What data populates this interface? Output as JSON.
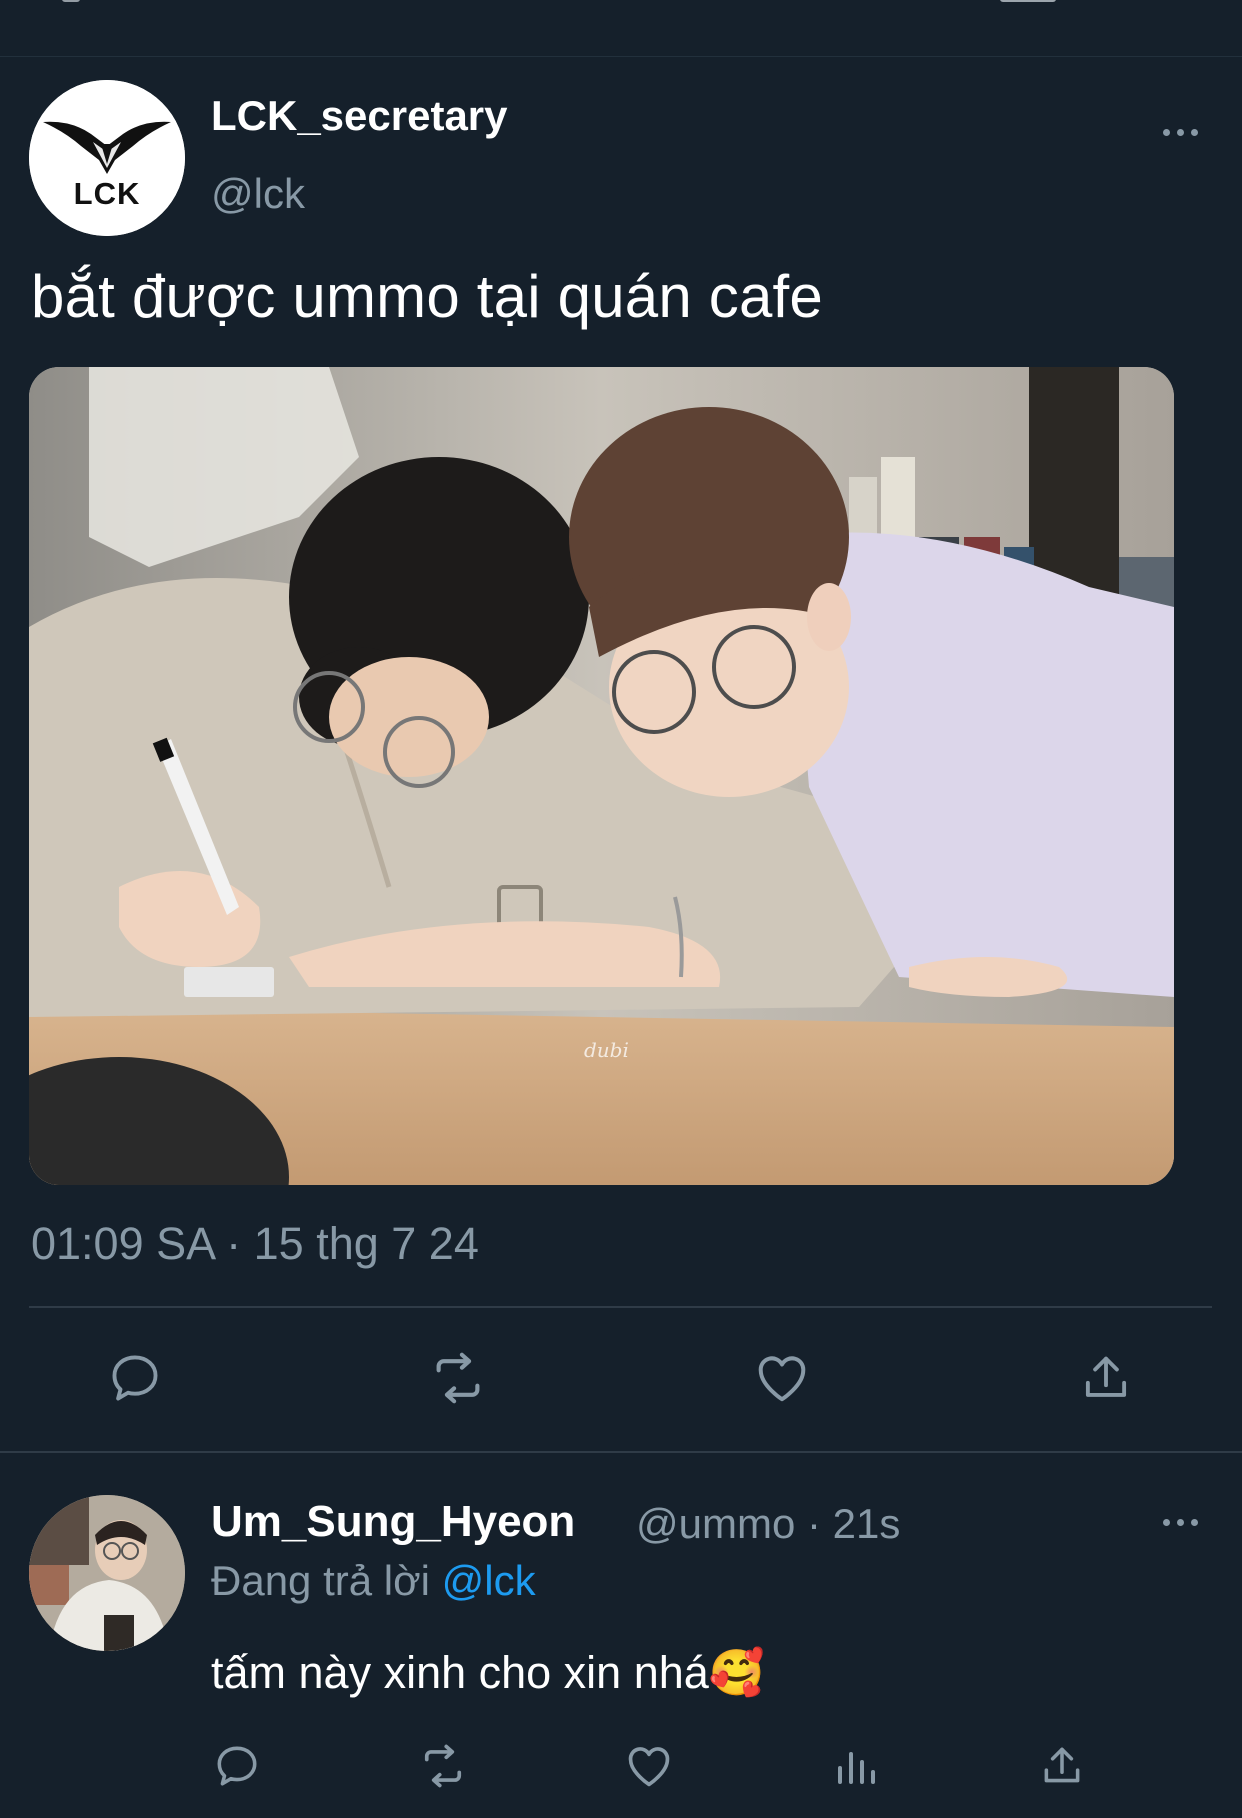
{
  "tweet": {
    "author": {
      "name": "LCK_secretary",
      "handle": "@lck",
      "avatar_logo_text": "LCK"
    },
    "text": "bắt được ummo tại quán cafe",
    "timestamp": "01:09 SA · 15 thg 7 24",
    "photo_watermark": "dubi",
    "actions": [
      "reply-icon",
      "retweet-icon",
      "like-icon",
      "share-icon"
    ]
  },
  "reply": {
    "author": {
      "name": "Um_Sung_Hyeon",
      "handle": "@ummo",
      "time": "21s"
    },
    "meta": "@ummo · 21s",
    "replying_prefix": "Đang trả lời",
    "replying_to": "@lck",
    "text": "tấm này xinh cho xin nhá🥰",
    "actions": [
      "reply-icon",
      "retweet-icon",
      "like-icon",
      "analytics-icon",
      "share-icon"
    ]
  },
  "colors": {
    "background": "#15202b",
    "text_primary": "#ffffff",
    "text_secondary": "#8899a6",
    "accent": "#1d9bf0",
    "divider": "#2f3b47"
  }
}
